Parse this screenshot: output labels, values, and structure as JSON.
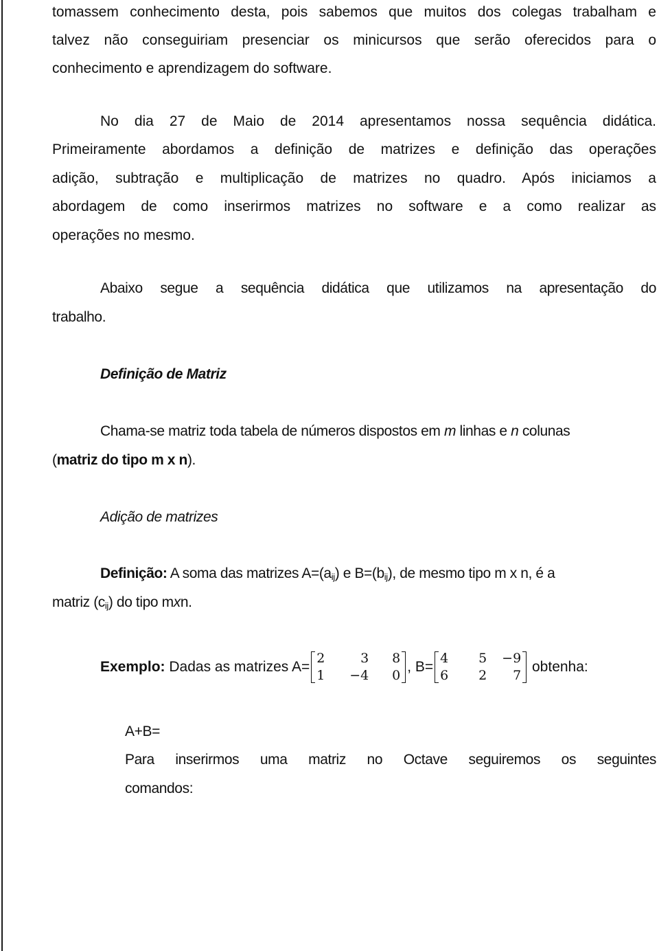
{
  "paragraph_intro": {
    "lines": [
      "tomassem conhecimento desta, pois sabemos que muitos dos colegas trabalham e",
      "talvez não conseguiriam presenciar os minicursos que serão oferecidos para o",
      "conhecimento e aprendizagem do software."
    ]
  },
  "paragraph_sequence": {
    "lines": [
      "No dia 27 de Maio de 2014 apresentamos nossa sequência didática.",
      "Primeiramente abordamos a definição de matrizes e definição das operações",
      "adição, subtração e multiplicação de matrizes no quadro. Após iniciamos a",
      "abordagem de como inserirmos matrizes no software e a como realizar as",
      "operações no mesmo."
    ]
  },
  "paragraph_below": {
    "lines": [
      "Abaixo segue a sequência didática que utilizamos na apresentação do",
      "trabalho."
    ]
  },
  "section_matrix_definition": {
    "heading": "Definição de Matriz",
    "text_part1": "Chama-se matriz toda tabela de números dispostos em ",
    "m": "m",
    "text_part2": " linhas e ",
    "n": "n",
    "text_part3": " colunas",
    "line2_open": "(",
    "line2_bold": "matriz do tipo m x n",
    "line2_close": ")."
  },
  "section_addition": {
    "heading": "Adição de matrizes",
    "def_label": "Definição:",
    "def_text1": " A soma das matrizes A=(a",
    "sub_ij": "ij",
    "def_text2": ") e B=(b",
    "def_text3": "), de mesmo tipo m x n, é a",
    "def_line2_a": "matriz (c",
    "def_line2_b": ") do tipo m",
    "def_line2_x": "x",
    "def_line2_c": "n."
  },
  "example": {
    "label": "Exemplo:",
    "text_before_A": " Dadas as matrizes A=",
    "separator": ", B=",
    "text_after_B": " obtenha:",
    "matrix_A": [
      [
        "2",
        "3",
        "8"
      ],
      [
        "1",
        "−4",
        "0"
      ]
    ],
    "matrix_B": [
      [
        "4",
        "5",
        "−9"
      ],
      [
        "6",
        "2",
        "7"
      ]
    ]
  },
  "task": {
    "sum_label": "A+B=",
    "octave_line1": "Para inserirmos uma matriz no Octave seguiremos os seguintes",
    "octave_line2": "comandos:"
  }
}
